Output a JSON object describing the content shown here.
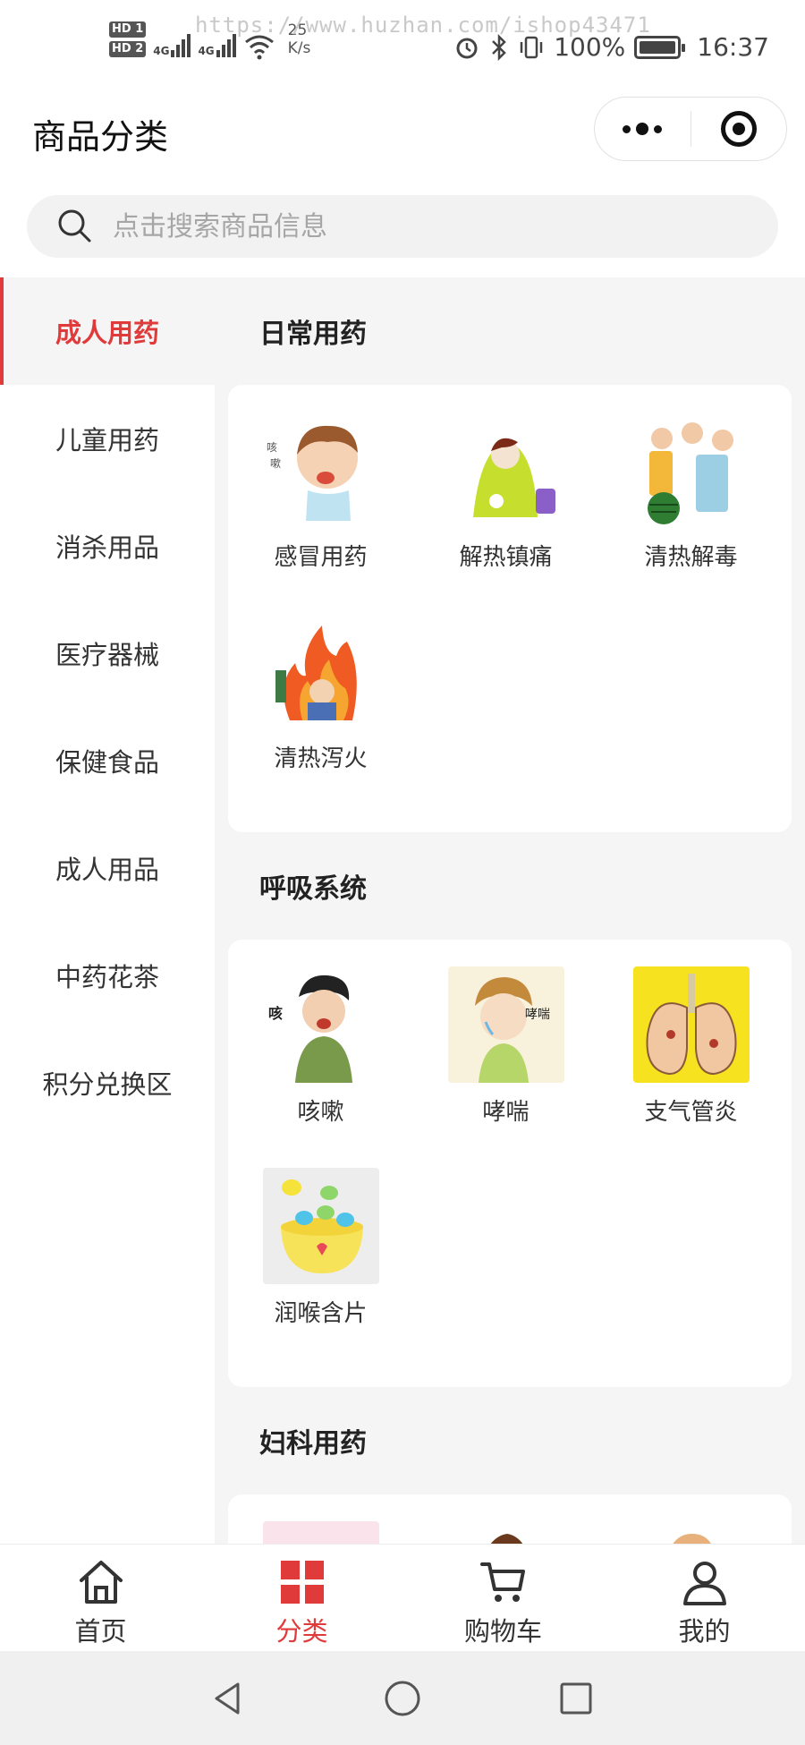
{
  "status_bar": {
    "hd1": "HD 1",
    "hd2": "HD 2",
    "net1": "4G",
    "net2": "4G",
    "speed_value": "25",
    "speed_unit": "K/s",
    "watermark": "https://www.huzhan.com/ishop43471",
    "battery": "100%",
    "time": "16:37"
  },
  "nav": {
    "title": "商品分类"
  },
  "search": {
    "placeholder": "点击搜索商品信息"
  },
  "sidebar": {
    "items": [
      {
        "label": "成人用药",
        "active": true
      },
      {
        "label": "儿童用药"
      },
      {
        "label": "消杀用品"
      },
      {
        "label": "医疗器械"
      },
      {
        "label": "保健食品"
      },
      {
        "label": "成人用品"
      },
      {
        "label": "中药花茶"
      },
      {
        "label": "积分兑换区"
      }
    ]
  },
  "sections": [
    {
      "title": "日常用药",
      "items": [
        {
          "label": "感冒用药",
          "icon": "cold-child-image"
        },
        {
          "label": "解热镇痛",
          "icon": "fever-blanket-image"
        },
        {
          "label": "清热解毒",
          "icon": "family-bottles-image"
        },
        {
          "label": "清热泻火",
          "icon": "fire-person-image"
        }
      ]
    },
    {
      "title": "呼吸系统",
      "items": [
        {
          "label": "咳嗽",
          "icon": "coughing-man-image"
        },
        {
          "label": "哮喘",
          "icon": "asthma-boy-image"
        },
        {
          "label": "支气管炎",
          "icon": "lungs-image"
        },
        {
          "label": "润喉含片",
          "icon": "lozenge-bowl-image"
        }
      ]
    },
    {
      "title": "妇科用药",
      "items": [
        {
          "label": "",
          "icon": "women-group-image"
        },
        {
          "label": "",
          "icon": "woman-face-image"
        },
        {
          "label": "",
          "icon": "elderly-woman-image"
        }
      ]
    }
  ],
  "tabbar": {
    "items": [
      {
        "label": "首页",
        "icon": "home-icon"
      },
      {
        "label": "分类",
        "icon": "category-icon",
        "active": true
      },
      {
        "label": "购物车",
        "icon": "cart-icon"
      },
      {
        "label": "我的",
        "icon": "user-icon"
      }
    ]
  },
  "colors": {
    "accent": "#e03a3a",
    "background": "#f5f5f5"
  }
}
